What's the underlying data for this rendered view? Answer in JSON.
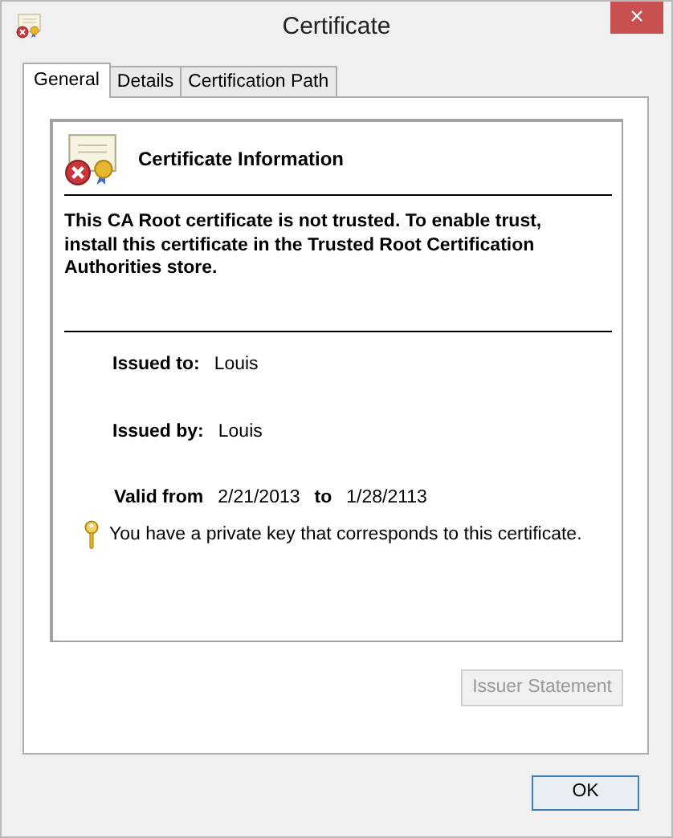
{
  "window": {
    "title": "Certificate",
    "close": "×"
  },
  "tabs": [
    {
      "label": "General",
      "selected": true
    },
    {
      "label": "Details",
      "selected": false
    },
    {
      "label": "Certification Path",
      "selected": false
    }
  ],
  "info": {
    "title": "Certificate Information",
    "message": "This CA Root certificate is not trusted. To enable trust, install this certificate in the Trusted Root Certification Authorities store.",
    "trusted": false
  },
  "fields": [
    {
      "label": "Issued to:",
      "value": "Louis"
    },
    {
      "label": "Issued by:",
      "value": "Louis"
    }
  ],
  "validity": {
    "from_label": "Valid from",
    "from": "2/21/2013",
    "to_label": "to",
    "to": "1/28/2113"
  },
  "private_key_note": "You have a private key that corresponds to this certificate.",
  "issuer_statement": {
    "label": "Issuer Statement",
    "disabled": true
  },
  "buttons": [
    {
      "label": "OK"
    }
  ]
}
